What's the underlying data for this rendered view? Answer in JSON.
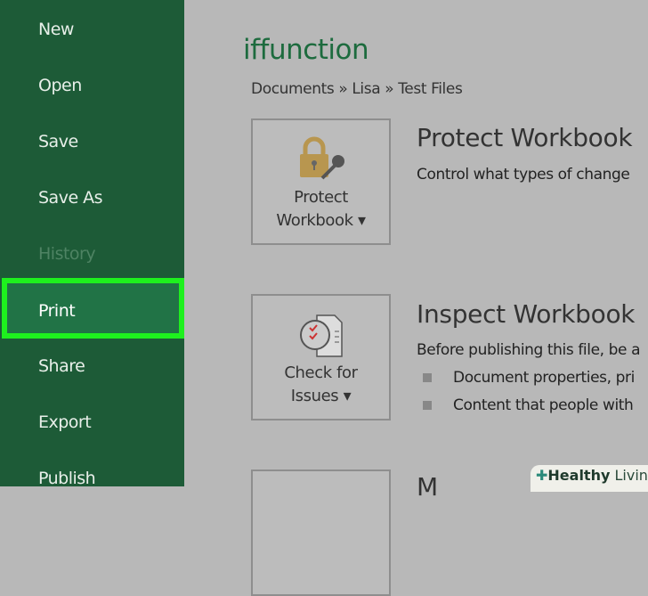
{
  "sidebar": {
    "items": [
      {
        "label": "New"
      },
      {
        "label": "Open"
      },
      {
        "label": "Save"
      },
      {
        "label": "Save As"
      },
      {
        "label": "History",
        "disabled": true
      },
      {
        "label": "Print",
        "highlighted": true
      },
      {
        "label": "Share"
      },
      {
        "label": "Export"
      },
      {
        "label": "Publish"
      }
    ]
  },
  "main": {
    "title": "iffunction",
    "breadcrumb": "Documents » Lisa » Test Files",
    "sections": [
      {
        "button_line1": "Protect",
        "button_line2": "Workbook ▾",
        "heading": "Protect Workbook",
        "description": "Control what types of change"
      },
      {
        "button_line1": "Check for",
        "button_line2": "Issues ▾",
        "heading": "Inspect Workbook",
        "description": "Before publishing this file, be a",
        "bullets": [
          "Document properties, pri",
          "Content that people with"
        ]
      },
      {
        "heading": "M"
      }
    ]
  },
  "watermark": {
    "bold": "Healthy",
    "text": " Living"
  },
  "colors": {
    "sidebar": "#1d5b37",
    "highlight": "#1ef01e",
    "title": "#1d6b3e"
  }
}
